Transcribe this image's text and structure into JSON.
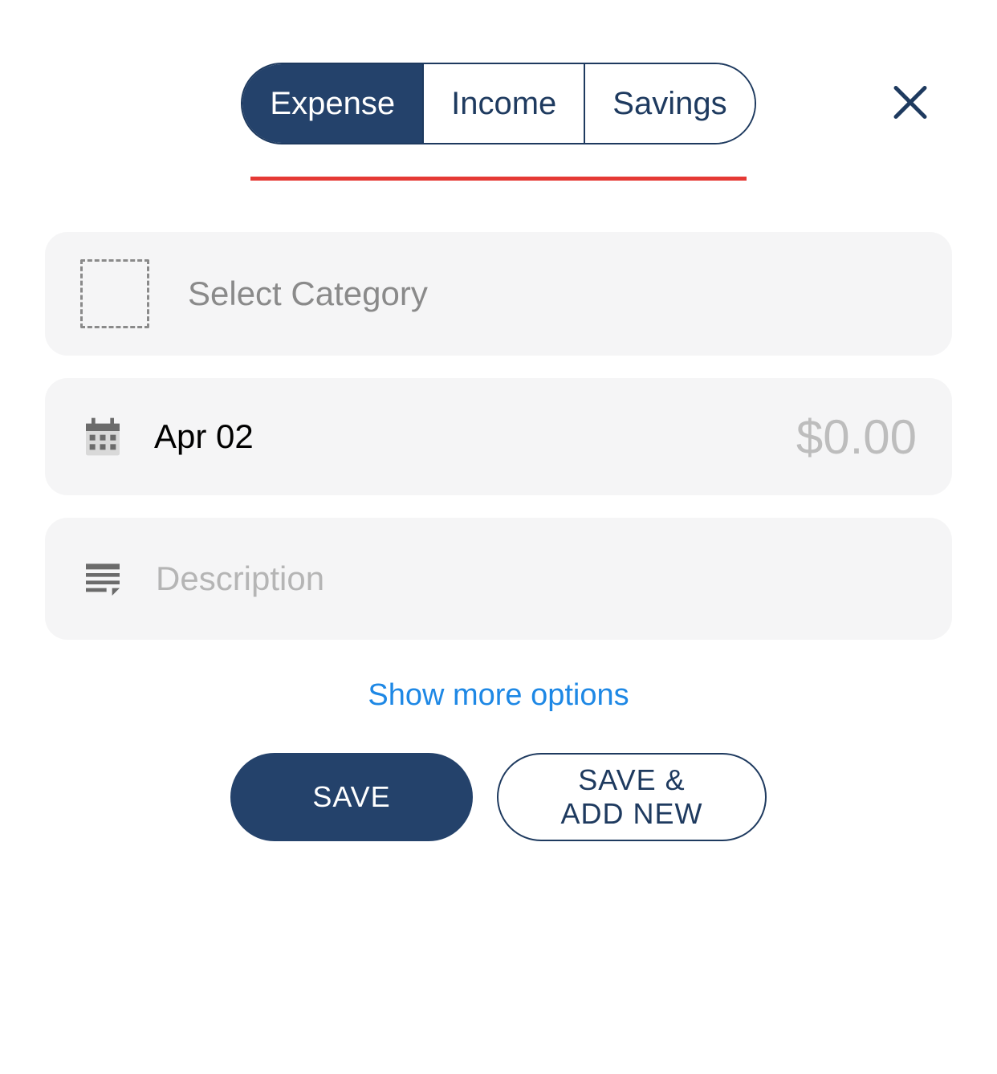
{
  "tabs": {
    "expense": "Expense",
    "income": "Income",
    "savings": "Savings"
  },
  "category": {
    "placeholder": "Select Category"
  },
  "date": {
    "value": "Apr 02"
  },
  "amount": {
    "value": "$0.00"
  },
  "description": {
    "placeholder": "Description"
  },
  "showMore": {
    "label": "Show more options"
  },
  "buttons": {
    "save": "SAVE",
    "saveAddNew": "SAVE & ADD NEW"
  }
}
